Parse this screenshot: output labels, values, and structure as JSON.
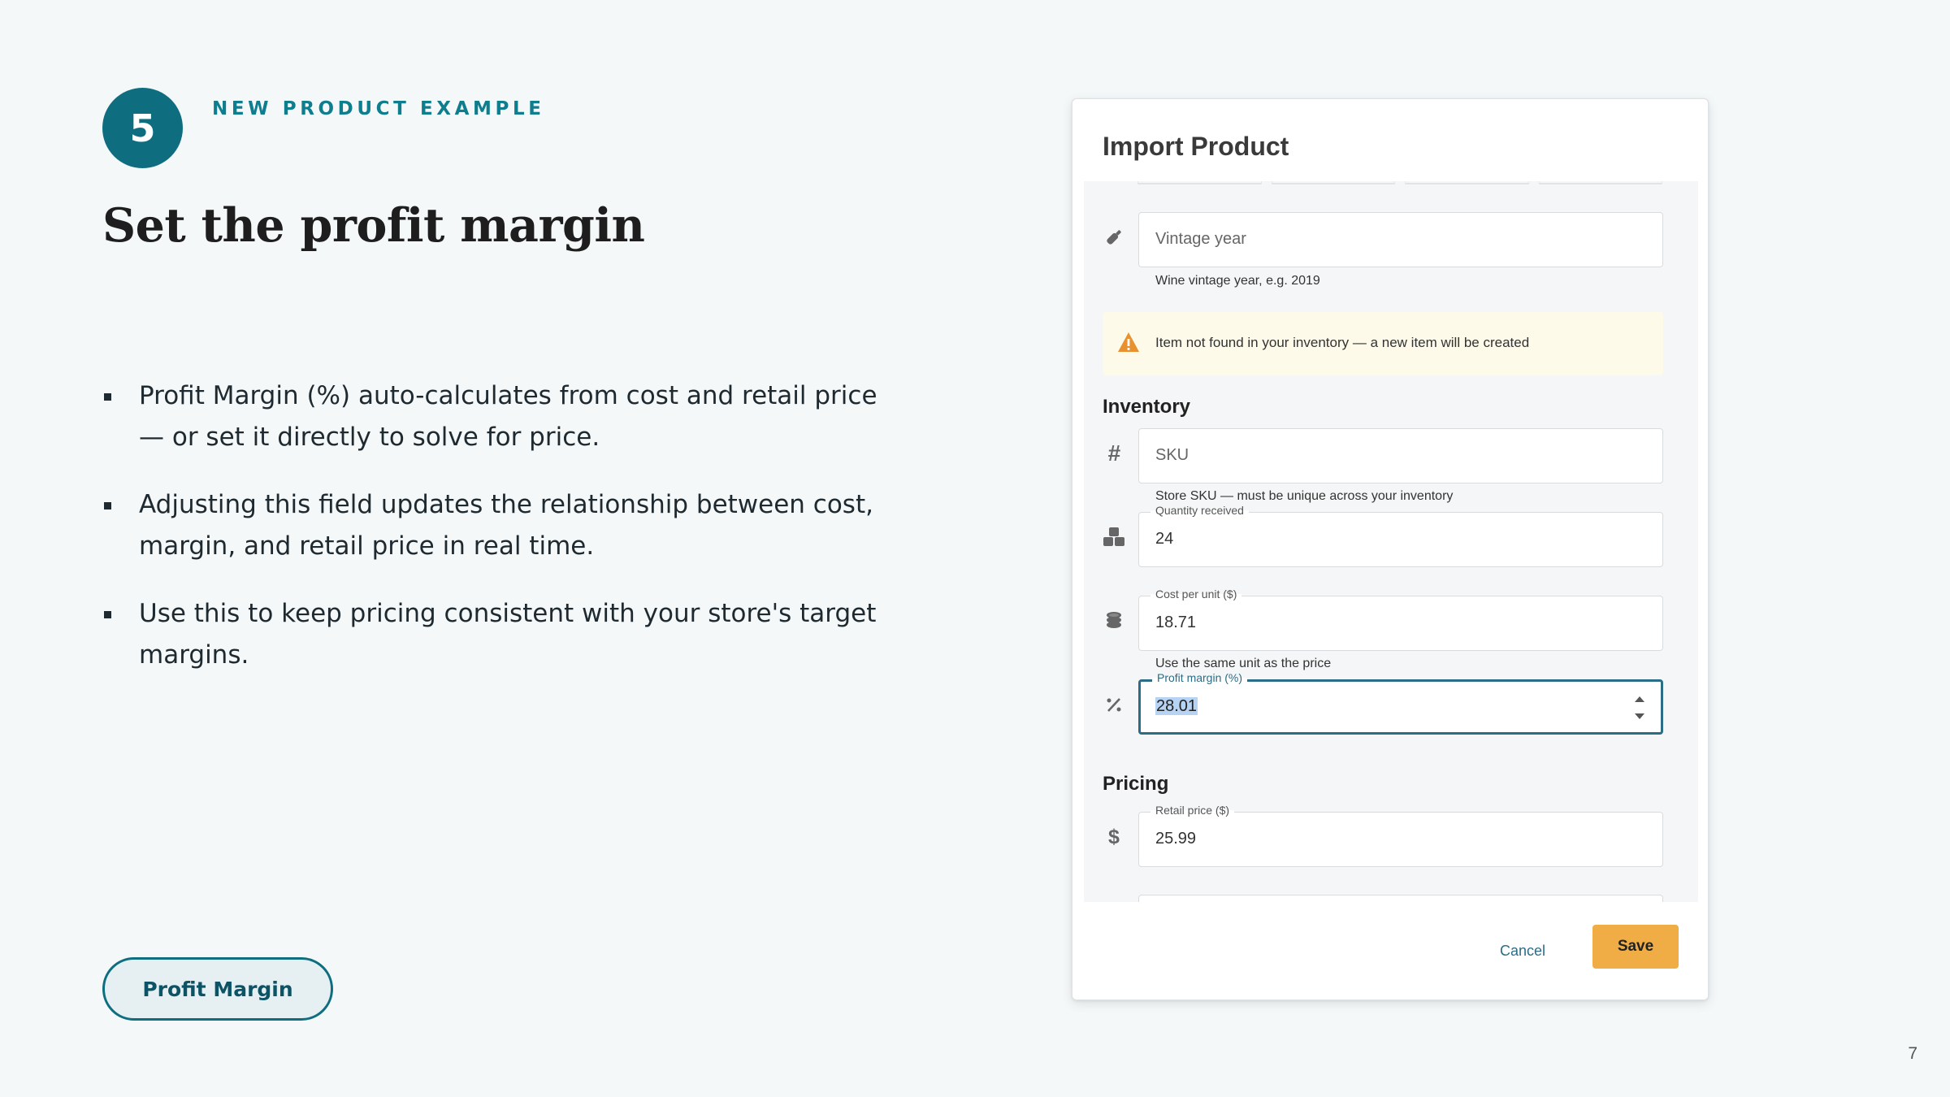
{
  "slide": {
    "step_number": "5",
    "eyebrow": "NEW PRODUCT EXAMPLE",
    "title": "Set the profit margin",
    "bullets": [
      "Profit Margin (%) auto-calculates from cost and retail price — or set it directly to solve for price.",
      "Adjusting this field updates the relationship between cost, margin, and retail price in real time.",
      "Use this to keep pricing consistent with your store's target margins."
    ],
    "pill_label": "Profit Margin",
    "page_number": "7"
  },
  "dialog": {
    "title": "Import Product",
    "vintage": {
      "icon": "wine-bottle-icon",
      "placeholder": "Vintage year",
      "helper": "Wine vintage year, e.g. 2019"
    },
    "warning": {
      "icon": "warning-icon",
      "text": "Item not found in your inventory — a new item will be created",
      "color": "#e8912f"
    },
    "inventory": {
      "heading": "Inventory",
      "sku": {
        "icon": "hash-icon",
        "placeholder": "SKU",
        "helper": "Store SKU — must be unique across your inventory"
      },
      "quantity": {
        "icon": "boxes-icon",
        "label": "Quantity received",
        "value": "24"
      },
      "cost": {
        "icon": "coins-icon",
        "label": "Cost per unit ($)",
        "value": "18.71",
        "helper": "Use the same unit as the price"
      },
      "margin": {
        "icon": "percent-icon",
        "label": "Profit margin (%)",
        "value": "28.01"
      }
    },
    "pricing": {
      "heading": "Pricing",
      "retail": {
        "icon": "dollar-icon",
        "label": "Retail price ($)",
        "value": "25.99"
      }
    },
    "footer": {
      "cancel_label": "Cancel",
      "save_label": "Save"
    }
  },
  "colors": {
    "accent": "#0e6e80",
    "save_button": "#f0ac45",
    "focus_border": "#2b6c86",
    "warning_bg": "#fdfae9"
  }
}
